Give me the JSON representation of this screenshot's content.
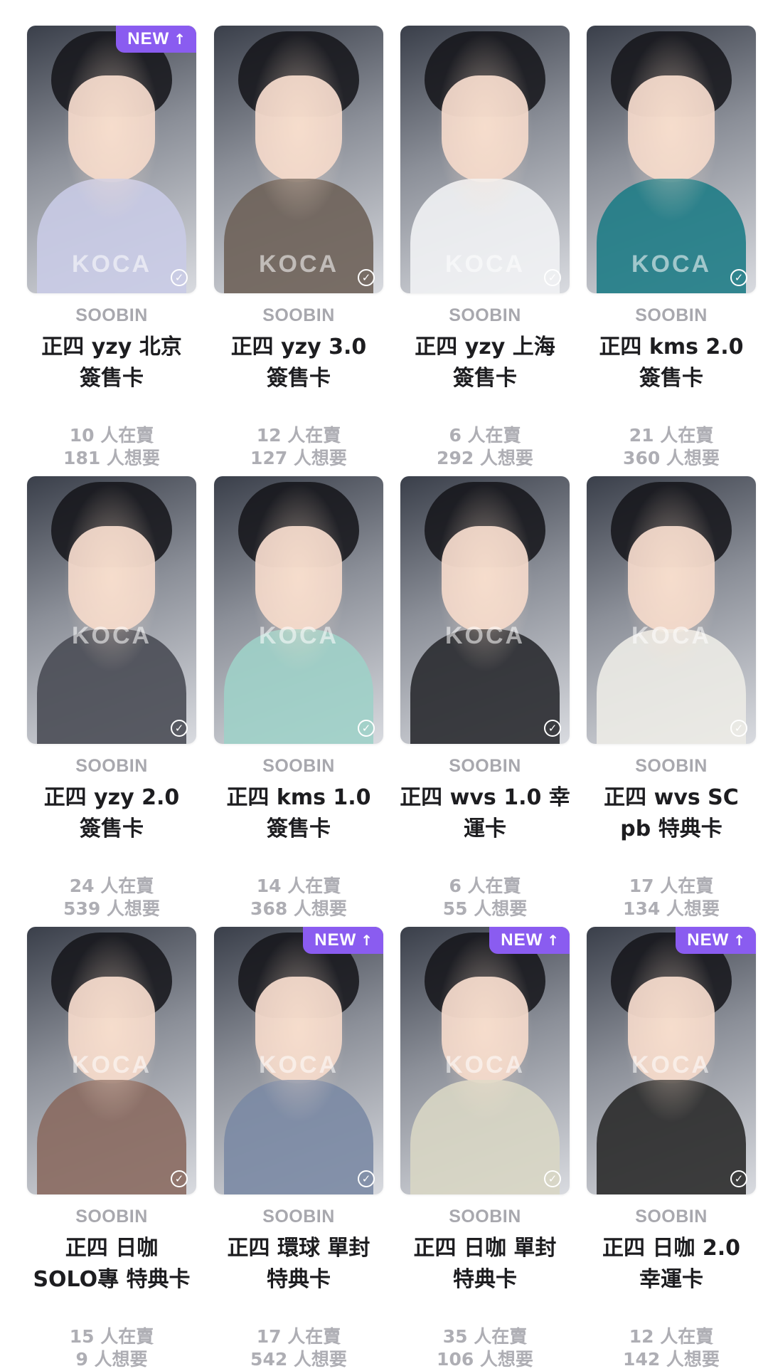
{
  "cards": [
    {
      "artist": "SOOBIN",
      "title_line1": "正四 yzy 北京",
      "title_line2": "簽售卡",
      "selling": "10 人在賣",
      "wanting": "181 人想要",
      "badge": "NEW",
      "badge_arrow": "↑",
      "watermark": "KOCA",
      "body_color": "#c9cbe6"
    },
    {
      "artist": "SOOBIN",
      "title_line1": "正四 yzy 3.0",
      "title_line2": "簽售卡",
      "selling": "12 人在賣",
      "wanting": "127 人想要",
      "badge": "",
      "badge_arrow": "",
      "watermark": "KOCA",
      "body_color": "#6e6259"
    },
    {
      "artist": "SOOBIN",
      "title_line1": "正四 yzy 上海",
      "title_line2": "簽售卡",
      "selling": "6 人在賣",
      "wanting": "292 人想要",
      "badge": "",
      "badge_arrow": "",
      "watermark": "KOCA",
      "body_color": "#f1f2f4"
    },
    {
      "artist": "SOOBIN",
      "title_line1": "正四 kms 2.0",
      "title_line2": "簽售卡",
      "selling": "21 人在賣",
      "wanting": "360 人想要",
      "badge": "",
      "badge_arrow": "",
      "watermark": "KOCA",
      "body_color": "#1f7c86"
    },
    {
      "artist": "SOOBIN",
      "title_line1": "正四 yzy 2.0",
      "title_line2": "簽售卡",
      "selling": "24 人在賣",
      "wanting": "539 人想要",
      "badge": "",
      "badge_arrow": "",
      "watermark": "KOCA",
      "body_color": "#4a4d55"
    },
    {
      "artist": "SOOBIN",
      "title_line1": "正四 kms 1.0",
      "title_line2": "簽售卡",
      "selling": "14 人在賣",
      "wanting": "368 人想要",
      "badge": "",
      "badge_arrow": "",
      "watermark": "KOCA",
      "body_color": "#9fd0c8"
    },
    {
      "artist": "SOOBIN",
      "title_line1": "正四 wvs 1.0 幸",
      "title_line2": "運卡",
      "selling": "6 人在賣",
      "wanting": "55 人想要",
      "badge": "",
      "badge_arrow": "",
      "watermark": "KOCA",
      "body_color": "#2a2b30"
    },
    {
      "artist": "SOOBIN",
      "title_line1": "正四 wvs SC",
      "title_line2": "pb 特典卡",
      "selling": "17 人在賣",
      "wanting": "134 人想要",
      "badge": "",
      "badge_arrow": "",
      "watermark": "KOCA",
      "body_color": "#ecebe6"
    },
    {
      "artist": "SOOBIN",
      "title_line1": "正四 日咖",
      "title_line2": "SOLO專 特典卡",
      "selling": "15 人在賣",
      "wanting": "9 人想要",
      "badge": "",
      "badge_arrow": "",
      "watermark": "KOCA",
      "body_color": "#8a6a60"
    },
    {
      "artist": "SOOBIN",
      "title_line1": "正四 環球 單封",
      "title_line2": "特典卡",
      "selling": "17 人在賣",
      "wanting": "542 人想要",
      "badge": "NEW",
      "badge_arrow": "↑",
      "watermark": "KOCA",
      "body_color": "#7b8aa4"
    },
    {
      "artist": "SOOBIN",
      "title_line1": "正四 日咖 單封",
      "title_line2": "特典卡",
      "selling": "35 人在賣",
      "wanting": "106 人想要",
      "badge": "NEW",
      "badge_arrow": "↑",
      "watermark": "KOCA",
      "body_color": "#d8d6c4"
    },
    {
      "artist": "SOOBIN",
      "title_line1": "正四 日咖 2.0",
      "title_line2": "幸運卡",
      "selling": "12 人在賣",
      "wanting": "142 人想要",
      "badge": "NEW",
      "badge_arrow": "↑",
      "watermark": "KOCA",
      "body_color": "#2b2b2b"
    }
  ],
  "accent_color": "#8a5cf0",
  "check_icon": "check-circle-icon"
}
